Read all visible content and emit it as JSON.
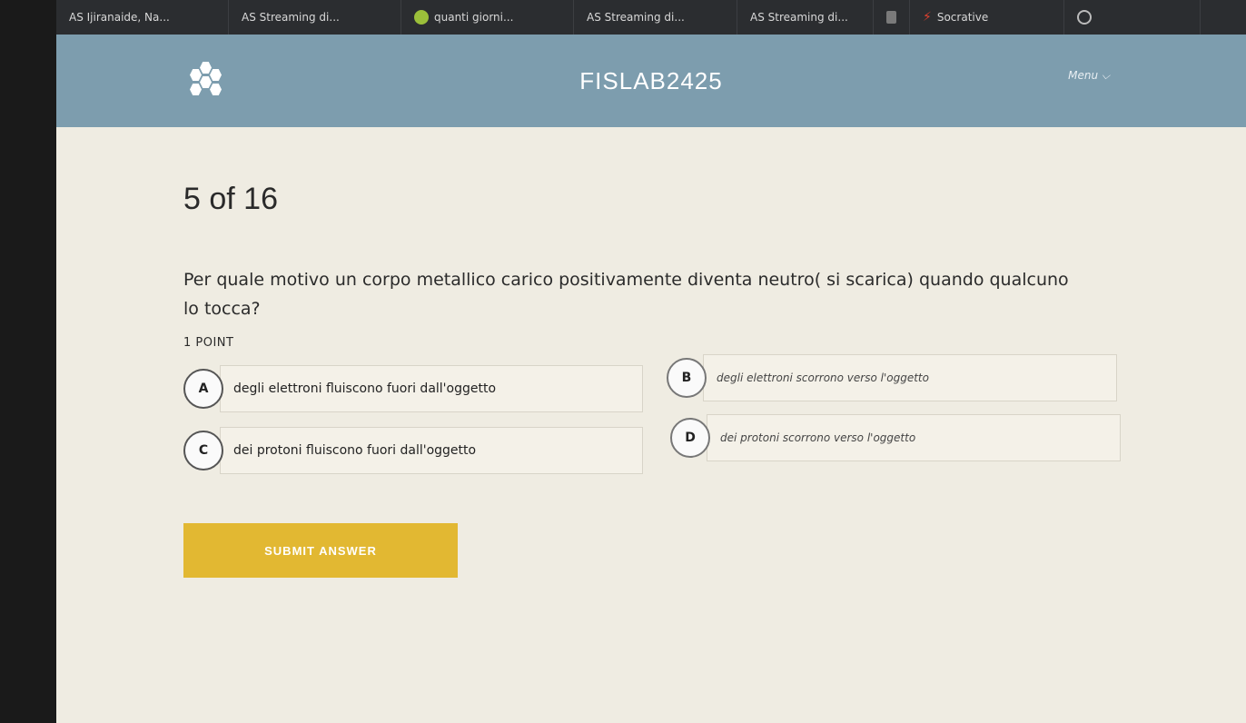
{
  "browser": {
    "tabs": [
      {
        "icon": "AS",
        "label": "AS Ijiranaide, Na..."
      },
      {
        "icon": "AS",
        "label": "AS Streaming di..."
      },
      {
        "icon": "circle-icon",
        "label": "quanti giorni..."
      },
      {
        "icon": "AS",
        "label": "AS Streaming di..."
      },
      {
        "icon": "AS",
        "label": "AS Streaming di..."
      },
      {
        "icon": "square-icon",
        "label": ""
      },
      {
        "icon": "bolt-icon",
        "label": "Socrative"
      },
      {
        "icon": "globe-icon",
        "label": ""
      }
    ]
  },
  "header": {
    "title": "FISLAB2425",
    "menu_label": "Menu ⌵"
  },
  "quiz": {
    "progress": "5 of 16",
    "question": "Per quale motivo un corpo metallico carico positivamente diventa neutro( si scarica) quando qualcuno lo tocca?",
    "points": "1 POINT",
    "options": [
      {
        "letter": "A",
        "text": "degli elettroni fluiscono fuori dall'oggetto"
      },
      {
        "letter": "B",
        "text": "degli elettroni scorrono verso l'oggetto"
      },
      {
        "letter": "C",
        "text": "dei protoni fluiscono fuori dall'oggetto"
      },
      {
        "letter": "D",
        "text": "dei protoni scorrono verso l'oggetto"
      }
    ],
    "submit_label": "SUBMIT ANSWER"
  },
  "colors": {
    "header_bg": "#7d9dae",
    "page_bg": "#efece2",
    "submit_bg": "#e2b832"
  }
}
